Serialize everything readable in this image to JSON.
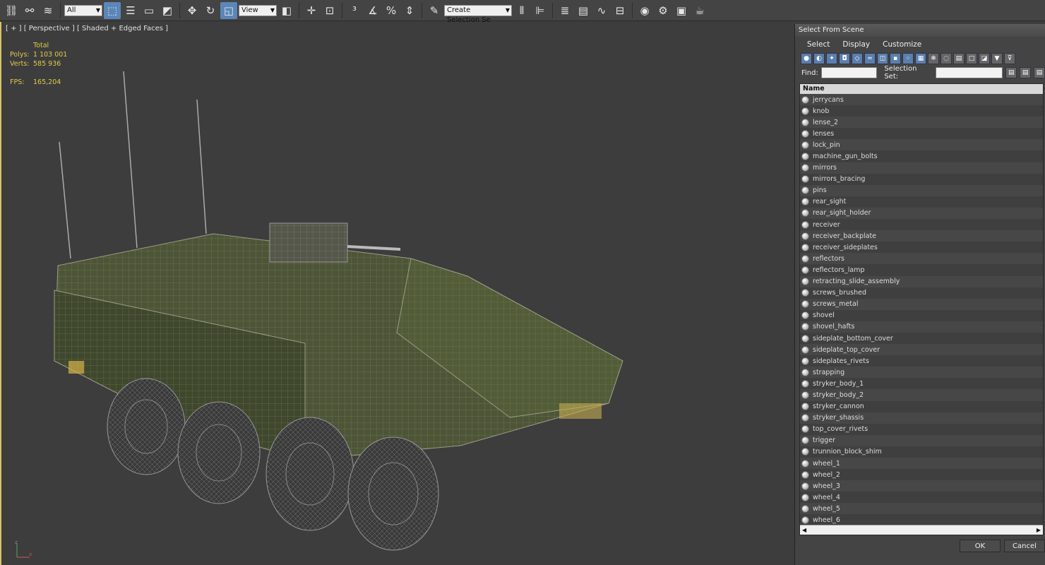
{
  "toolbar": {
    "filter_value": "All",
    "reference_value": "View",
    "selection_set_placeholder": "Create Selection Se"
  },
  "viewport": {
    "label": "[ + ] [ Perspective ] [ Shaded + Edged Faces ]",
    "stats": {
      "total_label": "Total",
      "polys_label": "Polys:",
      "polys_value": "1 103 001",
      "verts_label": "Verts:",
      "verts_value": "585 936",
      "fps_label": "FPS:",
      "fps_value": "165,204"
    },
    "axis_x": "x",
    "axis_z": "z"
  },
  "dialog": {
    "title": "Select From Scene",
    "menus": [
      "Select",
      "Display",
      "Customize"
    ],
    "find_label": "Find:",
    "selection_set_label": "Selection Set:",
    "column_header": "Name",
    "items": [
      "jerrycans",
      "knob",
      "lense_2",
      "lenses",
      "lock_pin",
      "machine_gun_bolts",
      "mirrors",
      "mirrors_bracing",
      "pins",
      "rear_sight",
      "rear_sight_holder",
      "receiver",
      "receiver_backplate",
      "receiver_sideplates",
      "reflectors",
      "reflectors_lamp",
      "retracting_slide_assembly",
      "screws_brushed",
      "screws_metal",
      "shovel",
      "shovel_hafts",
      "sideplate_bottom_cover",
      "sideplate_top_cover",
      "sideplates_rivets",
      "strapping",
      "stryker_body_1",
      "stryker_body_2",
      "stryker_cannon",
      "stryker_shassis",
      "top_cover_rivets",
      "trigger",
      "trunnion_block_shim",
      "wheel_1",
      "wheel_2",
      "wheel_3",
      "wheel_4",
      "wheel_5",
      "wheel_6"
    ],
    "ok_label": "OK",
    "cancel_label": "Cancel"
  }
}
